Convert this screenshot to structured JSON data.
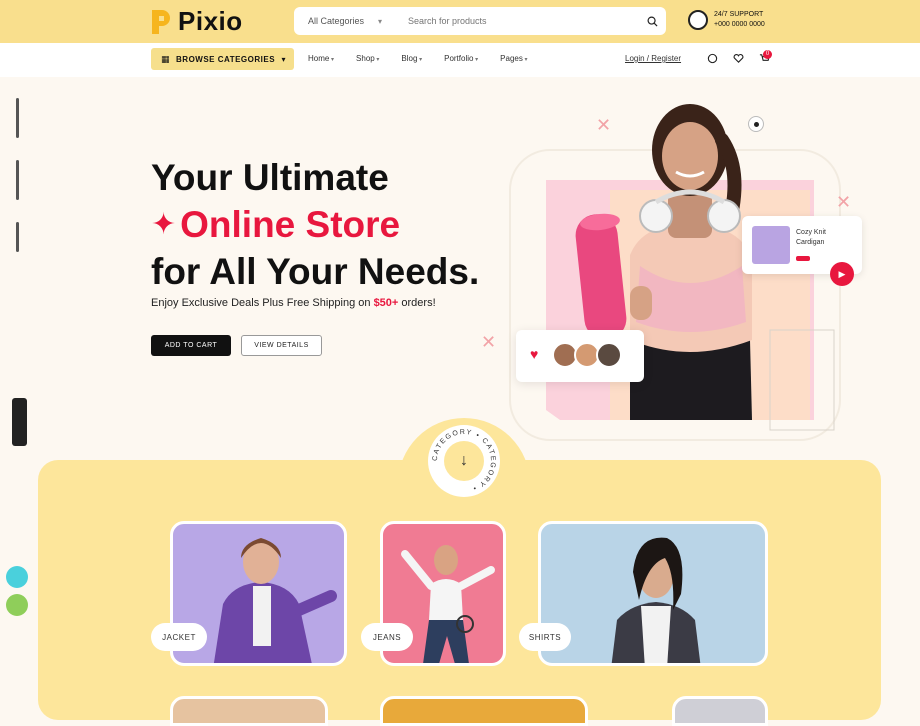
{
  "brand": {
    "name": "Pixio",
    "accent": "#f9df8d",
    "red": "#e8173e"
  },
  "search": {
    "category": "All Categories",
    "placeholder": "Search for products"
  },
  "support": {
    "line1": "24/7 SUPPORT",
    "line2": "+000 0000 0000"
  },
  "nav": {
    "browse_label": "BROWSE CATEGORIES",
    "links": [
      "Home",
      "Shop",
      "Blog",
      "Portfolio",
      "Pages"
    ],
    "login": "Login / Register",
    "icons": [
      "user-icon",
      "heart-icon",
      "cart-icon"
    ],
    "cart_count": "0"
  },
  "hero": {
    "line1": "Your Ultimate",
    "line2": "Online Store",
    "line3": "for All Your Needs.",
    "sub_pre": "Enjoy Exclusive Deals Plus Free Shipping on ",
    "sub_highlight": "$50+",
    "sub_post": " orders!",
    "cta_primary": "ADD TO CART",
    "cta_secondary": "VIEW DETAILS",
    "promo_text_1": "Cozy Knit",
    "promo_text_2": "Cardigan"
  },
  "categories": {
    "badge_text": "CATEGORY • CATEGORY •",
    "items": [
      {
        "label": "JACKET"
      },
      {
        "label": "JEANS"
      },
      {
        "label": "SHIRTS"
      }
    ]
  }
}
